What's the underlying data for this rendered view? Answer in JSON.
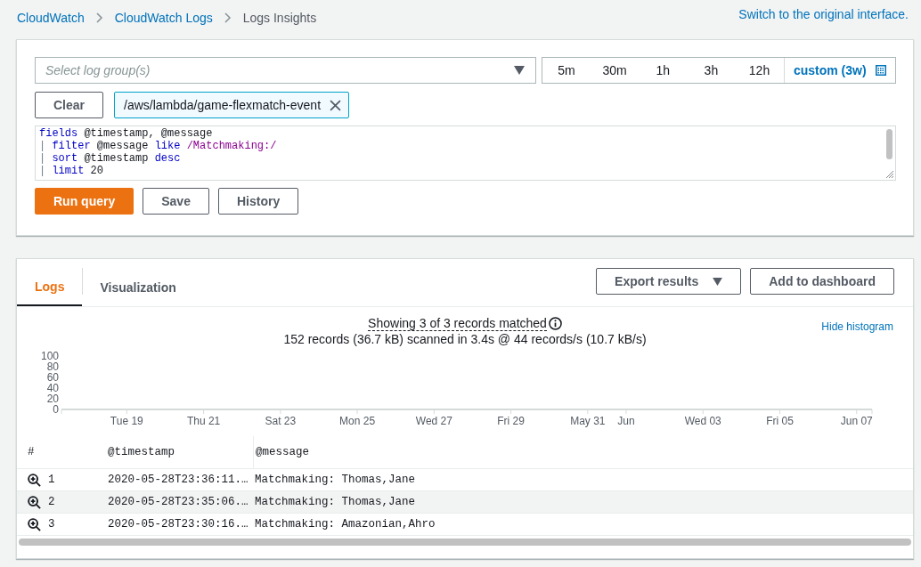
{
  "breadcrumbs": [
    {
      "label": "CloudWatch",
      "link": true
    },
    {
      "label": "CloudWatch Logs",
      "link": true
    },
    {
      "label": "Logs Insights",
      "link": false
    }
  ],
  "switch_link": "Switch to the original interface.",
  "log_group_select": {
    "placeholder": "Select log group(s)"
  },
  "time_ranges": [
    {
      "label": "5m",
      "selected": false
    },
    {
      "label": "30m",
      "selected": false
    },
    {
      "label": "1h",
      "selected": false
    },
    {
      "label": "3h",
      "selected": false
    },
    {
      "label": "12h",
      "selected": false
    },
    {
      "label": "custom (3w)",
      "selected": true
    }
  ],
  "clear_button": "Clear",
  "selected_groups": [
    "/aws/lambda/game-flexmatch-event"
  ],
  "query_lines": [
    [
      {
        "kind": "keyword",
        "text": "fields"
      },
      {
        "kind": "plain",
        "text": " @timestamp, @message"
      }
    ],
    [
      {
        "kind": "pipe",
        "text": "| "
      },
      {
        "kind": "keyword",
        "text": "filter"
      },
      {
        "kind": "plain",
        "text": " @message "
      },
      {
        "kind": "keyword",
        "text": "like"
      },
      {
        "kind": "regex",
        "text": " /Matchmaking:/"
      }
    ],
    [
      {
        "kind": "pipe",
        "text": "| "
      },
      {
        "kind": "keyword",
        "text": "sort"
      },
      {
        "kind": "plain",
        "text": " @timestamp "
      },
      {
        "kind": "keyword",
        "text": "desc"
      }
    ],
    [
      {
        "kind": "pipe",
        "text": "| "
      },
      {
        "kind": "keyword",
        "text": "limit"
      },
      {
        "kind": "plain",
        "text": " 20"
      }
    ]
  ],
  "query_buttons": [
    {
      "label": "Run query",
      "kind": "primary"
    },
    {
      "label": "Save",
      "kind": "normal"
    },
    {
      "label": "History",
      "kind": "normal"
    }
  ],
  "result_tabs": [
    {
      "label": "Logs",
      "selected": true
    },
    {
      "label": "Visualization",
      "selected": false
    }
  ],
  "result_actions": [
    {
      "label": "Export results",
      "kind": "dropdown"
    },
    {
      "label": "Add to dashboard",
      "kind": "normal"
    }
  ],
  "summary": "Showing 3 of 3 records matched",
  "scan_stats": "152 records (36.7 kB) scanned in 3.4s @ 44 records/s (10.7 kB/s)",
  "hide_histogram": "Hide histogram",
  "histogram": {
    "chart_data": {
      "type": "bar",
      "ylim": [
        0,
        100
      ],
      "yticks": [
        0,
        20,
        40,
        60,
        80,
        100
      ],
      "categories": [
        null,
        "Tue 19",
        null,
        "Thu 21",
        null,
        "Sat 23",
        null,
        "Mon 25",
        null,
        "Wed 27",
        null,
        "Fri 29",
        null,
        "May 31",
        "Jun",
        null,
        "Wed 03",
        null,
        "Fri 05",
        null,
        "Jun 07"
      ]
    }
  },
  "table": {
    "columns": [
      "#",
      "@timestamp",
      "@message"
    ],
    "rows": [
      {
        "cells": [
          "1",
          "2020-05-28T23:36:11.…",
          "Matchmaking: Thomas,Jane"
        ]
      },
      {
        "cells": [
          "2",
          "2020-05-28T23:35:06.…",
          "Matchmaking: Thomas,Jane"
        ]
      },
      {
        "cells": [
          "3",
          "2020-05-28T23:30:16.…",
          "Matchmaking: Amazonian,Ahro"
        ]
      }
    ]
  }
}
